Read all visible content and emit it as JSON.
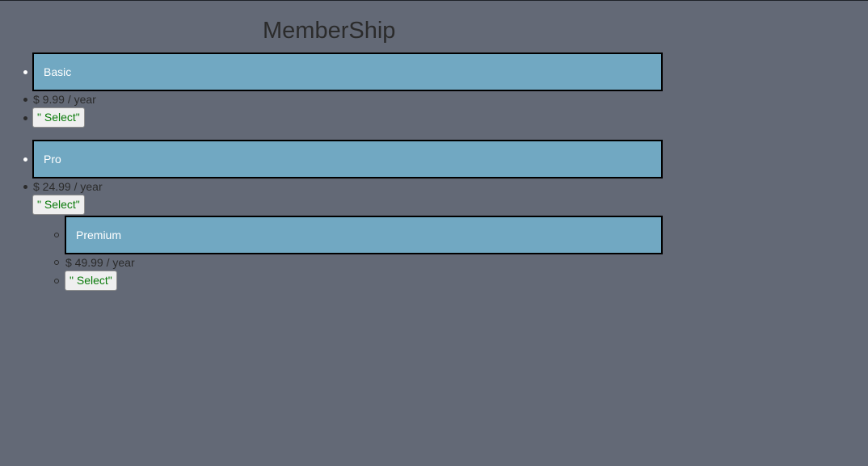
{
  "page": {
    "title": "MemberShip"
  },
  "plans": [
    {
      "name": "Basic",
      "price": "$ 9.99 / year",
      "select_label": "\" Select\""
    },
    {
      "name": "Pro",
      "price": "$ 24.99 / year",
      "select_label": "\" Select\""
    },
    {
      "name": "Premium",
      "price": "$ 49.99 / year",
      "select_label": "\" Select\""
    }
  ],
  "colors": {
    "background": "#636976",
    "plan_box": "#71a8c2",
    "select_text": "#0a7a0a"
  }
}
